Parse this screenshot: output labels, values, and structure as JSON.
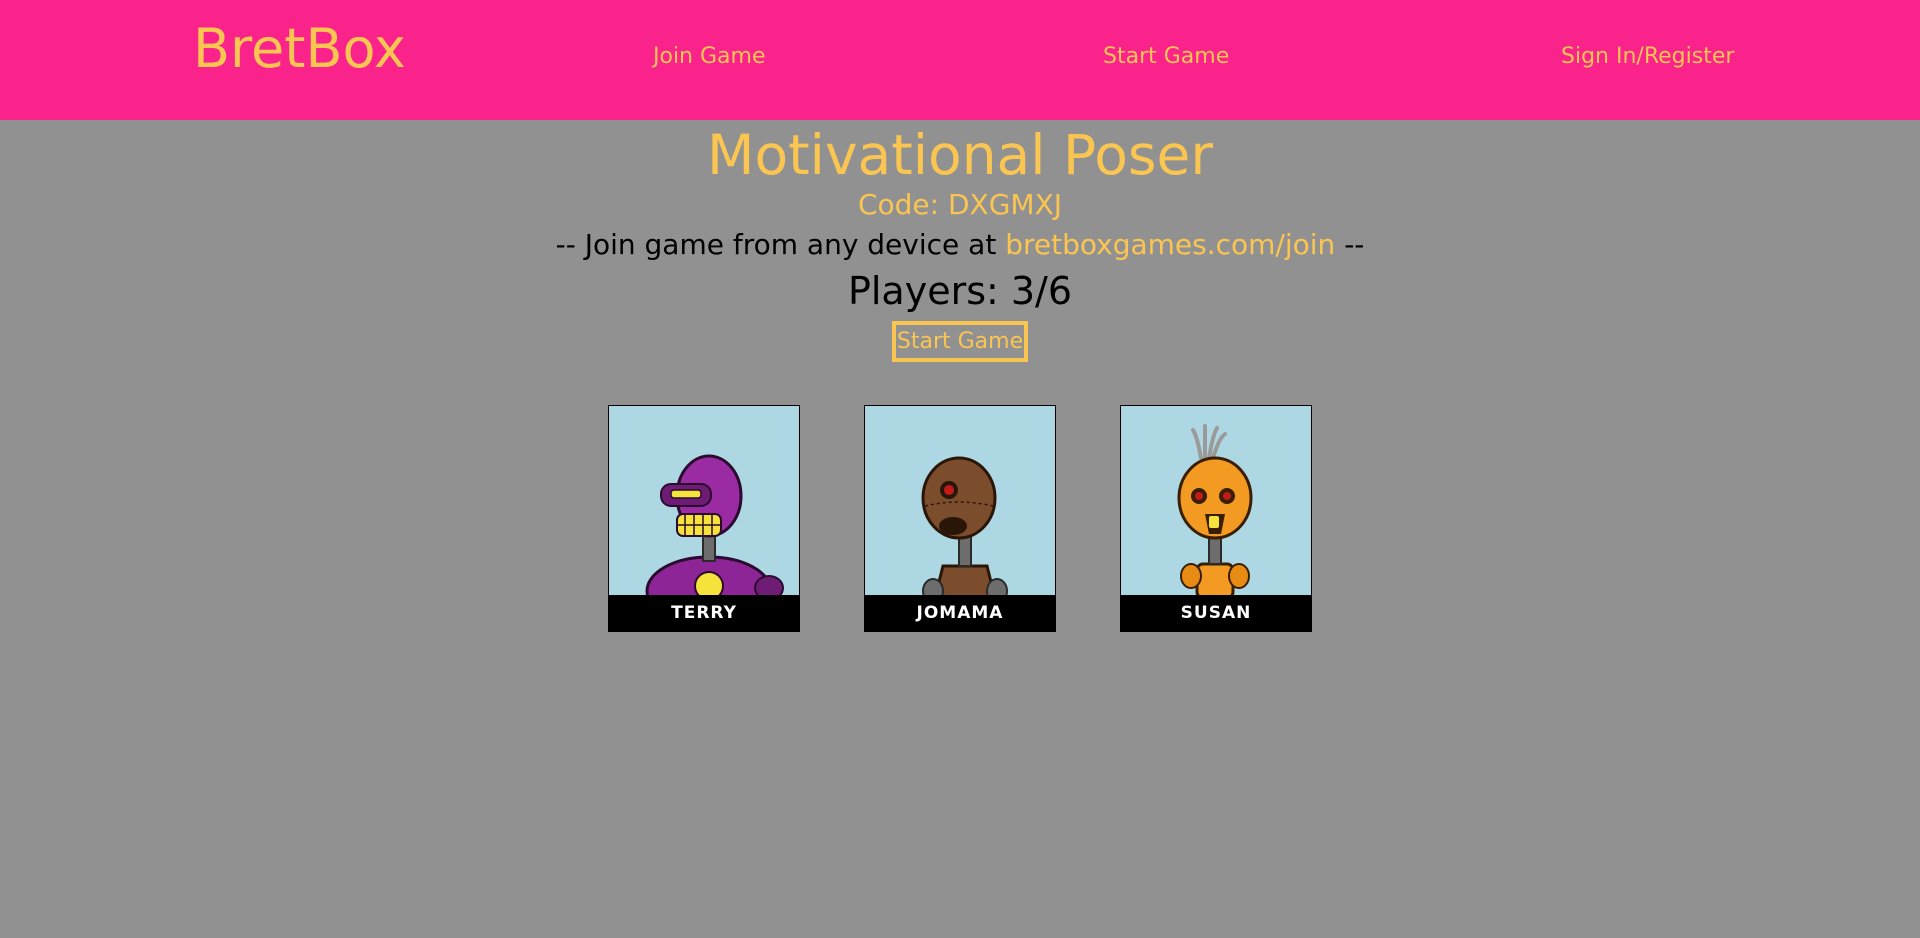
{
  "nav": {
    "brand": "BretBox",
    "join_game": "Join Game",
    "start_game": "Start Game",
    "sign_in": "Sign In/Register"
  },
  "game": {
    "title": "Motivational Poser",
    "code": "Code: DXGMXJ",
    "join_prefix": "-- Join game from any device at ",
    "join_url": "bretboxgames.com/join",
    "join_suffix": " --",
    "players": "Players: 3/6",
    "start_button": "Start Game"
  },
  "players": [
    {
      "name": "TERRY",
      "color": "#8e2596",
      "avatar": "purple-robot-icon"
    },
    {
      "name": "JOMAMA",
      "color": "#7c4d2c",
      "avatar": "brown-robot-icon"
    },
    {
      "name": "SUSAN",
      "color": "#f39a22",
      "avatar": "orange-robot-icon"
    }
  ]
}
